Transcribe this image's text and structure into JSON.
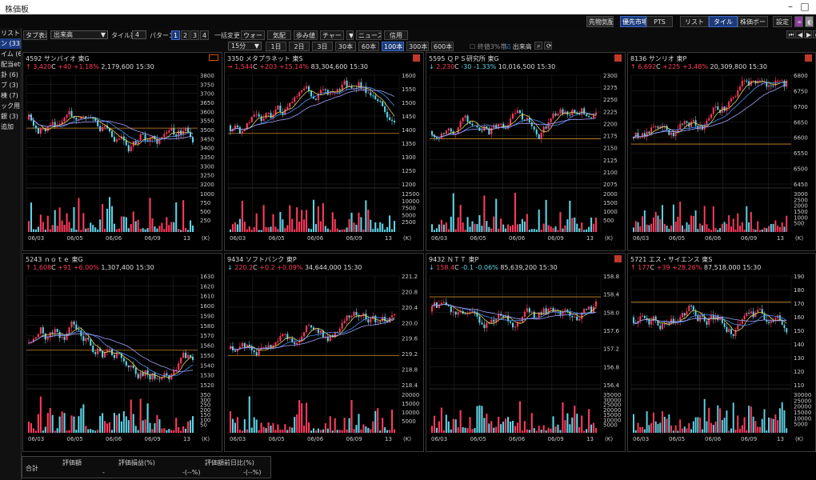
{
  "window": {
    "title": "株価板"
  },
  "topbar": {
    "btn1": "先物気配",
    "market_btns": [
      "優先市場",
      "PTS"
    ],
    "view_btns": [
      "リスト",
      "タイル",
      "株価ボード"
    ],
    "settings": "設定"
  },
  "sidebar": {
    "items": [
      "リスト",
      "ン (33)",
      "イム (6)",
      "配当etf",
      "卦 (6)",
      "ブ (3)",
      "棟 (7)",
      "ック用 (",
      "銀 (3)",
      "追加"
    ],
    "selected_index": 1
  },
  "toolbar": {
    "tab_display_btn": "タブ表示",
    "sort_value": "出来高",
    "tile_count_label": "タイル数",
    "tile_count_value": "4",
    "pattern_label": "パターン",
    "patterns": [
      "1",
      "2",
      "3",
      "4"
    ],
    "batch_label": "一括変更",
    "batch_btns": [
      "ウォート",
      "気配",
      "歩み値",
      "チャート",
      "▼",
      "ニュース",
      "信用"
    ],
    "interval_value": "15分",
    "range_btns": [
      "1日",
      "2日",
      "3日",
      "30本",
      "60本",
      "100本",
      "300本",
      "600本"
    ],
    "range_selected": "100本",
    "opt_close3": "終値3%帯",
    "opt_volume": "出来高"
  },
  "panels": [
    {
      "code": "4592",
      "name": "サンバイオ",
      "market": "東G",
      "arrow": "↑",
      "price": "3,420",
      "flag": "C",
      "change": "+40",
      "pct": "+1.18%",
      "volume": "2,179,600",
      "time": "15:30",
      "dir": "up",
      "icon": "orange",
      "yticks": [
        "3800",
        "3750",
        "3700",
        "3650",
        "3600",
        "3550",
        "3500",
        "3450",
        "3400",
        "3350",
        "3300",
        "3250",
        "3200"
      ],
      "vticks": [
        "1000",
        "750",
        "500",
        "250"
      ],
      "xlabels": [
        "06/03",
        "06/05",
        "06/06",
        "06/09",
        "13"
      ]
    },
    {
      "code": "3350",
      "name": "メタプラネット",
      "market": "東S",
      "arrow": "→",
      "price": "1,544",
      "flag": "C",
      "change": "+203",
      "pct": "+15.14%",
      "volume": "83,304,600",
      "time": "15:30",
      "dir": "up",
      "icon": "red",
      "yticks": [
        "1600",
        "1550",
        "1500",
        "1450",
        "1400",
        "1350",
        "1300",
        "1250",
        "1200"
      ],
      "vticks": [
        "12500",
        "10000",
        "7500",
        "5000",
        "2500"
      ],
      "xlabels": [
        "06/03",
        "06/05",
        "06/06",
        "06/09",
        "13"
      ]
    },
    {
      "code": "5595",
      "name": "ＱＰＳ研究所",
      "market": "東G",
      "arrow": "↓",
      "price": "2,230",
      "flag": "C",
      "change": "-30",
      "pct": "-1.33%",
      "volume": "10,016,500",
      "time": "15:30",
      "dir": "down",
      "icon": "red",
      "yticks": [
        "2300",
        "2275",
        "2250",
        "2225",
        "2200",
        "2175",
        "2150",
        "2125",
        "2100",
        "2075"
      ],
      "vticks": [
        "2000",
        "1500",
        "1000",
        "500"
      ],
      "xlabels": [
        "06/03",
        "06/05",
        "06/06",
        "06/09",
        "13"
      ]
    },
    {
      "code": "8136",
      "name": "サンリオ",
      "market": "東P",
      "arrow": "↑",
      "price": "6,692",
      "flag": "C",
      "change": "+225",
      "pct": "+3.48%",
      "volume": "20,309,800",
      "time": "15:30",
      "dir": "up",
      "icon": "red",
      "yticks": [
        "6800",
        "6750",
        "6700",
        "6650",
        "6600",
        "6550",
        "6500",
        "6450"
      ],
      "vticks": [
        "3000",
        "2500",
        "2000",
        "1500",
        "1000",
        "500"
      ],
      "xlabels": [
        "06/03",
        "06/05",
        "06/06",
        "06/09",
        "13"
      ]
    },
    {
      "code": "5243",
      "name": "ｎｏｔｅ",
      "market": "東G",
      "arrow": "↑",
      "price": "1,608",
      "flag": "C",
      "change": "+91",
      "pct": "+6.00%",
      "volume": "1,307,400",
      "time": "15:30",
      "dir": "up",
      "icon": "none",
      "yticks": [
        "1630",
        "1620",
        "1610",
        "1600",
        "1590",
        "1580",
        "1570",
        "1560",
        "1550",
        "1540",
        "1530",
        "1520"
      ],
      "vticks": [
        "350",
        "300",
        "250",
        "200",
        "150",
        "100",
        "50"
      ],
      "xlabels": [
        "06/03",
        "06/05",
        "06/06",
        "06/09",
        "13"
      ]
    },
    {
      "code": "9434",
      "name": "ソフトバンク",
      "market": "東P",
      "arrow": "↓",
      "price": "220.2",
      "flag": "C",
      "change": "+0.2",
      "pct": "+0.09%",
      "volume": "34,644,000",
      "time": "15:30",
      "dir": "down",
      "icon": "none",
      "yticks": [
        "221.2",
        "220.8",
        "220.4",
        "220.0",
        "219.6",
        "219.2",
        "218.8",
        "218.4"
      ],
      "vticks": [
        "20000",
        "15000",
        "10000",
        "5000"
      ],
      "xlabels": [
        "06/03",
        "06/05",
        "06/06",
        "06/09",
        "13"
      ]
    },
    {
      "code": "9432",
      "name": "ＮＴＴ",
      "market": "東P",
      "arrow": "↓",
      "price": "158.4",
      "flag": "C",
      "change": "-0.1",
      "pct": "-0.06%",
      "volume": "85,639,200",
      "time": "15:30",
      "dir": "down",
      "icon": "red",
      "yticks": [
        "158.8",
        "158.4",
        "158.0",
        "157.6",
        "157.2",
        "156.8",
        "156.4"
      ],
      "vticks": [
        "35000",
        "30000",
        "25000",
        "20000",
        "15000",
        "10000",
        "5000"
      ],
      "xlabels": [
        "06/03",
        "06/05",
        "06/06",
        "06/09",
        "13"
      ]
    },
    {
      "code": "5721",
      "name": "エス・サイエンス",
      "market": "東S",
      "arrow": "↑",
      "price": "177",
      "flag": "C",
      "change": "+39",
      "pct": "+28.26%",
      "volume": "87,518,000",
      "time": "15:30",
      "dir": "up",
      "icon": "none",
      "yticks": [
        "190",
        "180",
        "170",
        "160",
        "150",
        "140",
        "130",
        "120",
        "110"
      ],
      "vticks": [
        "30000",
        "25000",
        "20000",
        "15000",
        "10000",
        "5000"
      ],
      "xlabels": [
        "06/03",
        "06/05",
        "06/06",
        "06/09",
        "13"
      ]
    }
  ],
  "footer": {
    "total": "合計",
    "cols": [
      "評価額",
      "評価損益(%)",
      "評価額前日比(%)"
    ],
    "vals": [
      "-",
      "-(--%)",
      "-(--%)"
    ]
  },
  "colors": {
    "up": "#ff3b5c",
    "down": "#5fd4e6",
    "ma1": "#e0d060",
    "ma2": "#4a8ff0",
    "ma3": "#a0a0ff",
    "hline": "#d08a2a",
    "grid": "#2a2a2a"
  }
}
